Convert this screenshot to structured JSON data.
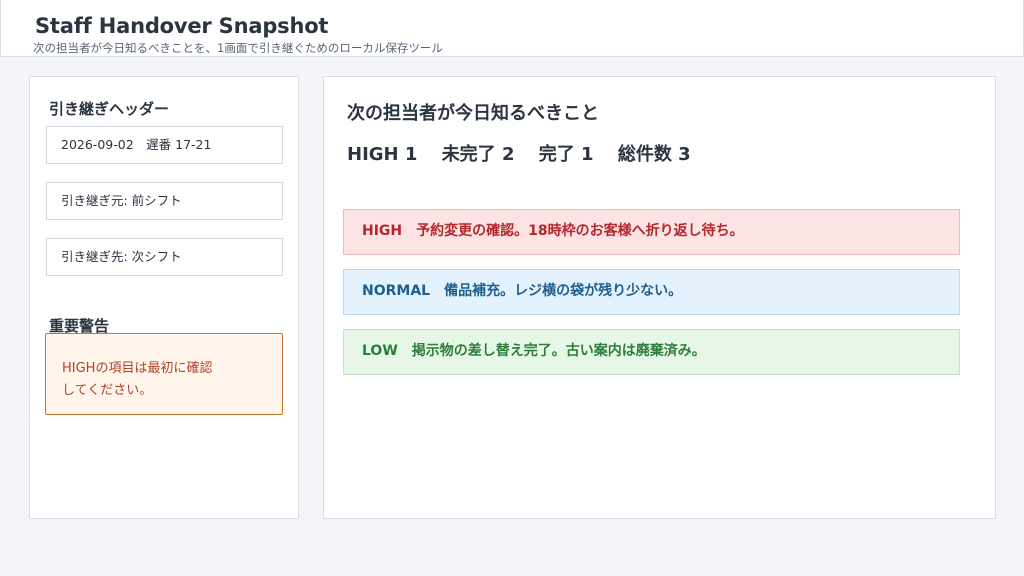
{
  "header": {
    "title": "Staff Handover Snapshot",
    "subtitle": "次の担当者が今日知るべきことを、1画面で引き継ぐためのローカル保存ツール"
  },
  "sidebar": {
    "heading": "引き継ぎヘッダー",
    "date_shift": "2026-09-02　遅番 17-21",
    "from": "引き継ぎ元: 前シフト",
    "to": "引き継ぎ先: 次シフト",
    "warning_heading": "重要警告",
    "warning_line1": "HIGHの項目は最初に確認",
    "warning_line2": "してください。"
  },
  "main": {
    "title": "次の担当者が今日知るべきこと",
    "stats": {
      "high": "HIGH 1",
      "incomplete": "未完了 2",
      "done": "完了 1",
      "total": "総件数 3"
    },
    "items": [
      {
        "level": "HIGH",
        "text": "予約変更の確認。18時枠のお客様へ折り返し待ち。",
        "color": "#b3282d",
        "bg": "#fde3e3",
        "border": "#f2b9ba"
      },
      {
        "level": "NORMAL",
        "text": "備品補充。レジ横の袋が残り少ない。",
        "color": "#1f5f8f",
        "bg": "#e4f2fd",
        "border": "#b6dbf6"
      },
      {
        "level": "LOW",
        "text": "掲示物の差し替え完了。古い案内は廃棄済み。",
        "color": "#2e7d3a",
        "bg": "#e6f7e8",
        "border": "#bfe7c5"
      }
    ]
  }
}
